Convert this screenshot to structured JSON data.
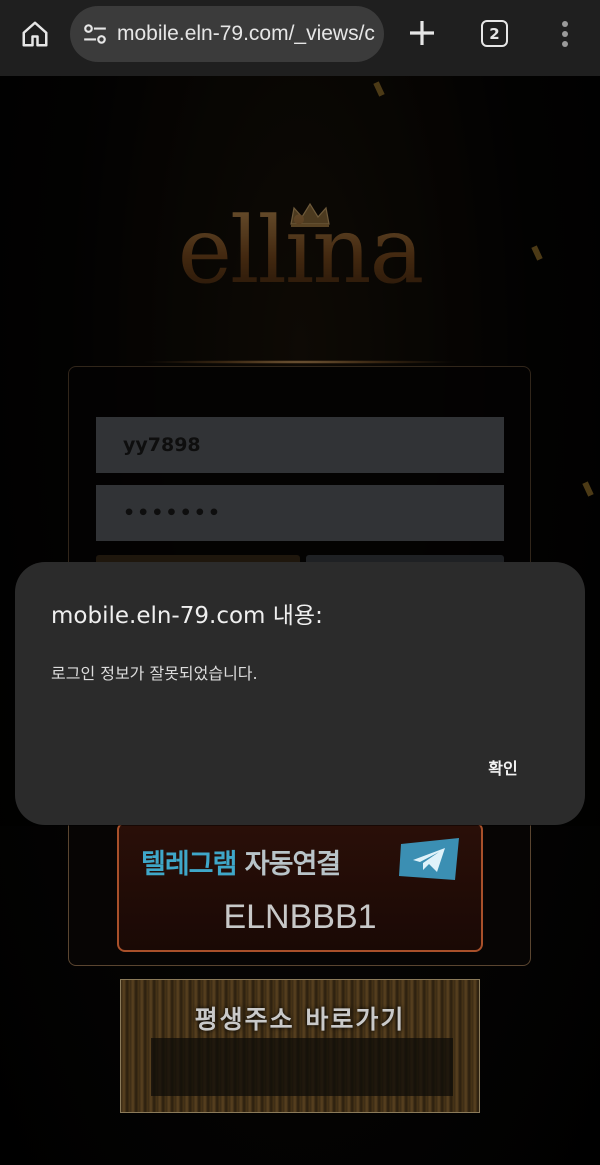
{
  "browser": {
    "url": "mobile.eln-79.com/_views/c",
    "tab_count": "2"
  },
  "page": {
    "logo": "ellina",
    "login": {
      "id_value": "yy7898",
      "password_mask": "•••••••"
    },
    "telegram": {
      "label_part1": "텔레그램",
      "label_part2": "자동연결",
      "code": "ELNBBB1"
    },
    "address_banner": "평생주소 바로가기"
  },
  "dialog": {
    "title": "mobile.eln-79.com 내용:",
    "message": "로그인 정보가 잘못되었습니다.",
    "ok_label": "확인"
  },
  "colors": {
    "browser_bar": "#1f1f1f",
    "dialog_bg": "#2b2b2b",
    "telegram_border": "#a8502a",
    "logo_gold": "#c99a5b"
  }
}
